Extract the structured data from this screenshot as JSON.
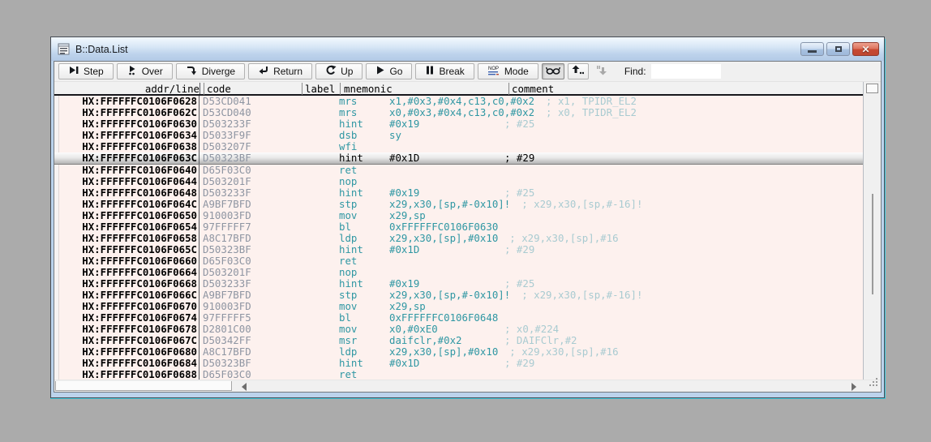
{
  "window": {
    "title": "B::Data.List",
    "controls": {
      "minimize": "minimize",
      "maximize": "maximize",
      "close": "close"
    }
  },
  "toolbar": {
    "buttons": [
      {
        "label": "Step",
        "icon": "step-into-icon"
      },
      {
        "label": "Over",
        "icon": "step-over-icon"
      },
      {
        "label": "Diverge",
        "icon": "diverge-icon"
      },
      {
        "label": "Return",
        "icon": "return-icon"
      },
      {
        "label": "Up",
        "icon": "up-arrow-circular-icon"
      },
      {
        "label": "Go",
        "icon": "go-play-icon"
      },
      {
        "label": "Break",
        "icon": "break-pause-icon"
      },
      {
        "label": "Mode",
        "icon": "mode-asm-hll-icon"
      }
    ],
    "icon_buttons": [
      {
        "icon": "spectacles-icon",
        "pressed": true,
        "disabled": false
      },
      {
        "icon": "arrow-up-dots-icon",
        "pressed": false,
        "disabled": false
      },
      {
        "icon": "arrow-down-quote-icon",
        "pressed": false,
        "disabled": true
      }
    ],
    "find_label": "Find:",
    "find_value": "",
    "find_placeholder": ""
  },
  "listing": {
    "columns": [
      "addr/line",
      "code",
      "label",
      "mnemonic",
      "comment"
    ],
    "rows": [
      {
        "addr": "HX:FFFFFFC0106F0628",
        "code": "D53CD041",
        "label": "",
        "mnemonic": "mrs",
        "operands": "x1,#0x3,#0x4,c13,c0,#0x2",
        "comment": "; x1, TPIDR_EL2",
        "highlighted": false
      },
      {
        "addr": "HX:FFFFFFC0106F062C",
        "code": "D53CD040",
        "label": "",
        "mnemonic": "mrs",
        "operands": "x0,#0x3,#0x4,c13,c0,#0x2",
        "comment": "; x0, TPIDR_EL2",
        "highlighted": false
      },
      {
        "addr": "HX:FFFFFFC0106F0630",
        "code": "D503233F",
        "label": "",
        "mnemonic": "hint",
        "operands": "#0x19",
        "comment": "; #25",
        "highlighted": false
      },
      {
        "addr": "HX:FFFFFFC0106F0634",
        "code": "D5033F9F",
        "label": "",
        "mnemonic": "dsb",
        "operands": "sy",
        "comment": "",
        "highlighted": false
      },
      {
        "addr": "HX:FFFFFFC0106F0638",
        "code": "D503207F",
        "label": "",
        "mnemonic": "wfi",
        "operands": "",
        "comment": "",
        "highlighted": false
      },
      {
        "addr": "HX:FFFFFFC0106F063C",
        "code": "D50323BF",
        "label": "",
        "mnemonic": "hint",
        "operands": "#0x1D",
        "comment": "; #29",
        "highlighted": true
      },
      {
        "addr": "HX:FFFFFFC0106F0640",
        "code": "D65F03C0",
        "label": "",
        "mnemonic": "ret",
        "operands": "",
        "comment": "",
        "highlighted": false
      },
      {
        "addr": "HX:FFFFFFC0106F0644",
        "code": "D503201F",
        "label": "",
        "mnemonic": "nop",
        "operands": "",
        "comment": "",
        "highlighted": false
      },
      {
        "addr": "HX:FFFFFFC0106F0648",
        "code": "D503233F",
        "label": "",
        "mnemonic": "hint",
        "operands": "#0x19",
        "comment": "; #25",
        "highlighted": false
      },
      {
        "addr": "HX:FFFFFFC0106F064C",
        "code": "A9BF7BFD",
        "label": "",
        "mnemonic": "stp",
        "operands": "x29,x30,[sp,#-0x10]!",
        "comment": "; x29,x30,[sp,#-16]!",
        "highlighted": false
      },
      {
        "addr": "HX:FFFFFFC0106F0650",
        "code": "910003FD",
        "label": "",
        "mnemonic": "mov",
        "operands": "x29,sp",
        "comment": "",
        "highlighted": false
      },
      {
        "addr": "HX:FFFFFFC0106F0654",
        "code": "97FFFFF7",
        "label": "",
        "mnemonic": "bl",
        "operands": "0xFFFFFFC0106F0630",
        "comment": "",
        "highlighted": false
      },
      {
        "addr": "HX:FFFFFFC0106F0658",
        "code": "A8C17BFD",
        "label": "",
        "mnemonic": "ldp",
        "operands": "x29,x30,[sp],#0x10",
        "comment": "; x29,x30,[sp],#16",
        "highlighted": false
      },
      {
        "addr": "HX:FFFFFFC0106F065C",
        "code": "D50323BF",
        "label": "",
        "mnemonic": "hint",
        "operands": "#0x1D",
        "comment": "; #29",
        "highlighted": false
      },
      {
        "addr": "HX:FFFFFFC0106F0660",
        "code": "D65F03C0",
        "label": "",
        "mnemonic": "ret",
        "operands": "",
        "comment": "",
        "highlighted": false
      },
      {
        "addr": "HX:FFFFFFC0106F0664",
        "code": "D503201F",
        "label": "",
        "mnemonic": "nop",
        "operands": "",
        "comment": "",
        "highlighted": false
      },
      {
        "addr": "HX:FFFFFFC0106F0668",
        "code": "D503233F",
        "label": "",
        "mnemonic": "hint",
        "operands": "#0x19",
        "comment": "; #25",
        "highlighted": false
      },
      {
        "addr": "HX:FFFFFFC0106F066C",
        "code": "A9BF7BFD",
        "label": "",
        "mnemonic": "stp",
        "operands": "x29,x30,[sp,#-0x10]!",
        "comment": "; x29,x30,[sp,#-16]!",
        "highlighted": false
      },
      {
        "addr": "HX:FFFFFFC0106F0670",
        "code": "910003FD",
        "label": "",
        "mnemonic": "mov",
        "operands": "x29,sp",
        "comment": "",
        "highlighted": false
      },
      {
        "addr": "HX:FFFFFFC0106F0674",
        "code": "97FFFFF5",
        "label": "",
        "mnemonic": "bl",
        "operands": "0xFFFFFFC0106F0648",
        "comment": "",
        "highlighted": false
      },
      {
        "addr": "HX:FFFFFFC0106F0678",
        "code": "D2801C00",
        "label": "",
        "mnemonic": "mov",
        "operands": "x0,#0xE0",
        "comment": "; x0,#224",
        "highlighted": false
      },
      {
        "addr": "HX:FFFFFFC0106F067C",
        "code": "D50342FF",
        "label": "",
        "mnemonic": "msr",
        "operands": "daifclr,#0x2",
        "comment": "; DAIFClr,#2",
        "highlighted": false
      },
      {
        "addr": "HX:FFFFFFC0106F0680",
        "code": "A8C17BFD",
        "label": "",
        "mnemonic": "ldp",
        "operands": "x29,x30,[sp],#0x10",
        "comment": "; x29,x30,[sp],#16",
        "highlighted": false
      },
      {
        "addr": "HX:FFFFFFC0106F0684",
        "code": "D50323BF",
        "label": "",
        "mnemonic": "hint",
        "operands": "#0x1D",
        "comment": "; #29",
        "highlighted": false
      },
      {
        "addr": "HX:FFFFFFC0106F0688",
        "code": "D65F03C0",
        "label": "",
        "mnemonic": "ret",
        "operands": "",
        "comment": "",
        "highlighted": false
      }
    ]
  },
  "colors": {
    "backdrop": "#ababab",
    "frame_blue": "#bcd3ec",
    "frame_accent_cyan": "#3fc6da",
    "listing_background": "#fdf1ee",
    "mnemonic_teal": "#2f97a3",
    "comment_gray_blue": "#a9cbd1",
    "code_gray": "#8e95a2",
    "selection_gradient_bottom": "#b4b4b4",
    "close_button_red": "#c74a33"
  }
}
